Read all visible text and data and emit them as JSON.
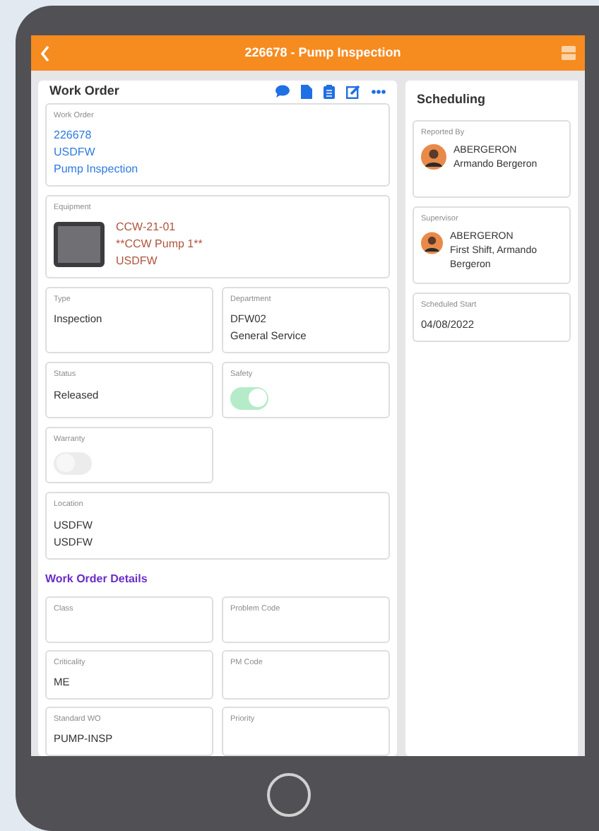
{
  "header": {
    "title": "226678 - Pump Inspection"
  },
  "work_order": {
    "title": "Work Order",
    "rows": [
      [
        {
          "kind": "link",
          "label": "Work Order",
          "lines": [
            "226678",
            "USDFW",
            "Pump Inspection"
          ]
        }
      ],
      [
        {
          "kind": "equipment",
          "label": "Equipment",
          "lines": [
            "CCW-21-01",
            "**CCW Pump 1**",
            "USDFW"
          ]
        }
      ],
      [
        {
          "kind": "text",
          "label": "Type",
          "lines": [
            "Inspection"
          ]
        },
        {
          "kind": "text",
          "label": "Department",
          "lines": [
            "DFW02",
            "General Service"
          ]
        }
      ],
      [
        {
          "kind": "text",
          "label": "Status",
          "lines": [
            "Released"
          ]
        },
        {
          "kind": "toggle",
          "label": "Safety",
          "on": true
        }
      ],
      [
        {
          "kind": "toggle",
          "label": "Warranty",
          "on": false
        }
      ],
      [
        {
          "kind": "text",
          "label": "Location",
          "lines": [
            "USDFW",
            "USDFW"
          ]
        }
      ]
    ],
    "details_heading": "Work Order Details",
    "details_rows": [
      [
        {
          "kind": "text",
          "label": "Class"
        },
        {
          "kind": "text",
          "label": "Problem Code"
        }
      ],
      [
        {
          "kind": "text",
          "label": "Criticality",
          "lines": [
            "ME"
          ]
        },
        {
          "kind": "text",
          "label": "PM Code"
        }
      ],
      [
        {
          "kind": "text",
          "label": "Standard WO",
          "lines": [
            "PUMP-INSP"
          ]
        },
        {
          "kind": "text",
          "label": "Priority"
        }
      ]
    ]
  },
  "scheduling": {
    "title": "Scheduling",
    "fields": [
      {
        "kind": "person",
        "label": "Reported By",
        "lines": [
          "ABERGERON",
          "Armando Bergeron"
        ]
      },
      {
        "kind": "person",
        "label": "Supervisor",
        "lines": [
          "ABERGERON",
          "First Shift, Armando Bergeron"
        ]
      },
      {
        "kind": "text",
        "label": "Scheduled Start",
        "lines": [
          "04/08/2022"
        ]
      }
    ]
  }
}
